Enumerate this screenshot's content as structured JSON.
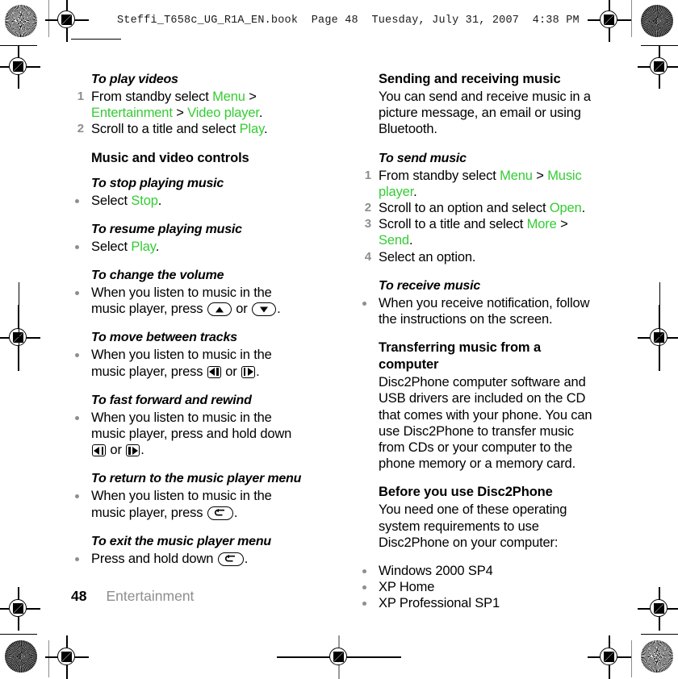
{
  "header": {
    "running_head": "Steffi_T658c_UG_R1A_EN.book  Page 48  Tuesday, July 31, 2007  4:38 PM"
  },
  "colors": {
    "menu_item_green": "#34cc34",
    "marker_gray": "#8e8e8e",
    "text_black": "#000000"
  },
  "left_column": {
    "play_videos": {
      "heading": "To play videos",
      "steps": [
        {
          "num": "1",
          "parts": [
            {
              "text": "From standby select ",
              "style": "plain"
            },
            {
              "text": "Menu",
              "style": "menu"
            },
            {
              "text": " > ",
              "style": "plain"
            },
            {
              "text": "Entertainment",
              "style": "menu"
            },
            {
              "text": " > ",
              "style": "plain"
            },
            {
              "text": "Video player",
              "style": "menu"
            },
            {
              "text": ".",
              "style": "plain"
            }
          ]
        },
        {
          "num": "2",
          "parts": [
            {
              "text": "Scroll to a title and select ",
              "style": "plain"
            },
            {
              "text": "Play",
              "style": "menu"
            },
            {
              "text": ".",
              "style": "plain"
            }
          ]
        }
      ]
    },
    "controls_heading": "Music and video controls",
    "stop": {
      "heading": "To stop playing music",
      "bullet_prefix": "Select ",
      "bullet_menu": "Stop",
      "bullet_suffix": "."
    },
    "resume": {
      "heading": "To resume playing music",
      "bullet_prefix": "Select ",
      "bullet_menu": "Play",
      "bullet_suffix": "."
    },
    "volume": {
      "heading": "To change the volume",
      "bullet_prefix": "When you listen to music in the music player, press ",
      "key_a": "volume-up-key",
      "between": " or ",
      "key_b": "volume-down-key",
      "bullet_suffix": "."
    },
    "tracks": {
      "heading": "To move between tracks",
      "bullet_prefix": "When you listen to music in the music player, press ",
      "key_a": "nav-left-key",
      "between": " or ",
      "key_b": "nav-right-key",
      "bullet_suffix": "."
    },
    "fastforward": {
      "heading": "To fast forward and rewind",
      "bullet_prefix": "When you listen to music in the music player, press and hold down ",
      "key_a": "nav-left-key",
      "between": " or ",
      "key_b": "nav-right-key",
      "bullet_suffix": "."
    },
    "return_menu": {
      "heading": "To return to the music player menu",
      "bullet_prefix": "When you listen to music in the music player, press ",
      "key_a": "back-key",
      "bullet_suffix": "."
    },
    "exit_menu": {
      "heading": "To exit the music player menu",
      "bullet_prefix": "Press and hold down ",
      "key_a": "back-key",
      "bullet_suffix": "."
    }
  },
  "right_column": {
    "sending": {
      "heading": "Sending and receiving music",
      "body": "You can send and receive music in a picture message, an email or using Bluetooth."
    },
    "send_music": {
      "heading": "To send music",
      "steps": [
        {
          "num": "1",
          "parts": [
            {
              "text": "From standby select ",
              "style": "plain"
            },
            {
              "text": "Menu",
              "style": "menu"
            },
            {
              "text": " > ",
              "style": "plain"
            },
            {
              "text": "Music player",
              "style": "menu"
            },
            {
              "text": ".",
              "style": "plain"
            }
          ]
        },
        {
          "num": "2",
          "parts": [
            {
              "text": "Scroll to an option and select ",
              "style": "plain"
            },
            {
              "text": "Open",
              "style": "menu"
            },
            {
              "text": ".",
              "style": "plain"
            }
          ]
        },
        {
          "num": "3",
          "parts": [
            {
              "text": "Scroll to a title and select ",
              "style": "plain"
            },
            {
              "text": "More",
              "style": "menu"
            },
            {
              "text": " > ",
              "style": "plain"
            },
            {
              "text": "Send",
              "style": "menu"
            },
            {
              "text": ".",
              "style": "plain"
            }
          ]
        },
        {
          "num": "4",
          "parts": [
            {
              "text": "Select an option.",
              "style": "plain"
            }
          ]
        }
      ]
    },
    "receive_music": {
      "heading": "To receive music",
      "bullet": "When you receive notification, follow the instructions on the screen."
    },
    "transferring": {
      "heading": "Transferring music from a computer",
      "body": "Disc2Phone computer software and USB drivers are included on the CD that comes with your phone. You can use Disc2Phone to transfer music from CDs or your computer to the phone memory or a memory card."
    },
    "before": {
      "heading": "Before you use Disc2Phone",
      "body": "You need one of these operating system requirements to use Disc2Phone on your computer:",
      "requirements": [
        "Windows 2000 SP4",
        "XP Home",
        "XP Professional SP1"
      ]
    }
  },
  "footer": {
    "page_number": "48",
    "section_title": "Entertainment"
  }
}
